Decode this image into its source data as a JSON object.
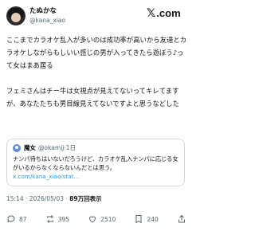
{
  "author": {
    "display_name": "たぬかな",
    "handle": "@kana_xiao"
  },
  "brand": {
    "logo_mark": "𝕏",
    "logo_text": ".com"
  },
  "post": {
    "paragraphs": [
      "ここまでカラオケ乱入が多いのは成功率が高いから友達とカラオケしながらもしいい感じの男が入ってきたら遊ぼう♪って女はまあ居る",
      "フェミさんはチー牛は女視点が見えてないってキレてますが、あなたたちも男目線見えてないですよと思うなどした"
    ]
  },
  "quote": {
    "name": "魔女",
    "handle": "@okamjj",
    "separator": "·",
    "age": "1日",
    "text": "ナンパ待ちはいないだろうけど、カラオケ乱入ナンパに応じる女がいるからなくならないんだとは思う。",
    "link": "x.com/kana_xiao/stat..."
  },
  "meta": {
    "time": "15:14 · 2026/05/03 · ",
    "views": "89万回表示"
  },
  "actions": {
    "replies": "87",
    "reposts": "395",
    "likes": "2510",
    "bookmarks": "240"
  }
}
